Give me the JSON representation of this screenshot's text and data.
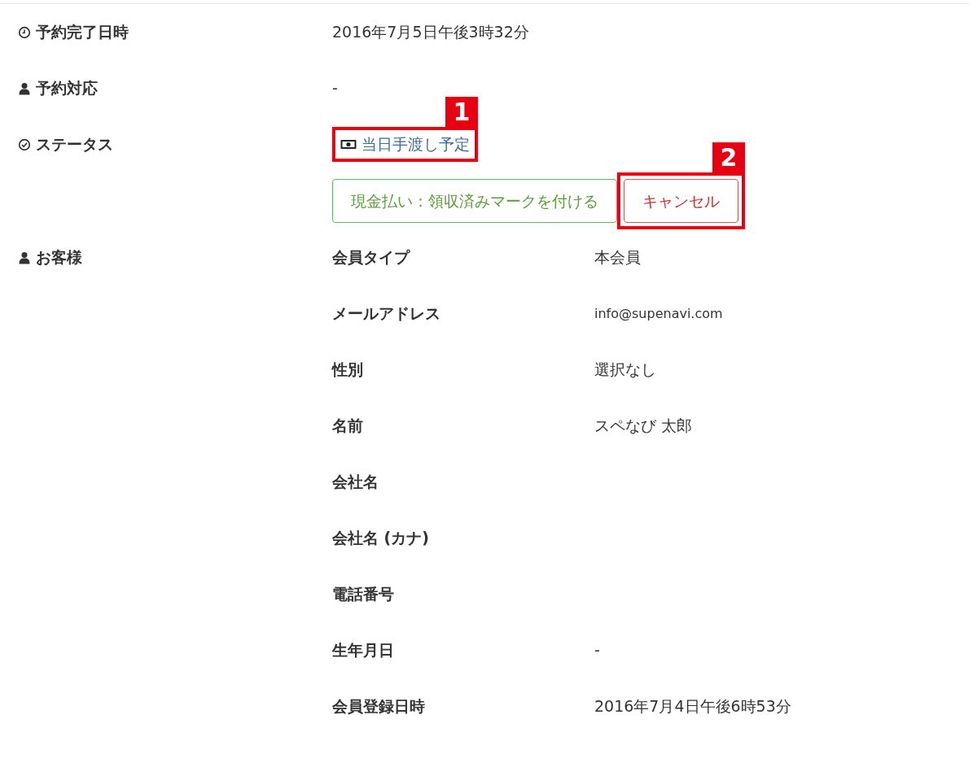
{
  "fields": [
    {
      "kind": "datetime",
      "label": "予約完了日時",
      "value": "2016年7月5日午後3時32分"
    },
    {
      "kind": "staff",
      "label": "予約対応",
      "value": "-"
    },
    {
      "kind": "status",
      "label": "ステータス",
      "status": {
        "text": "当日手渡し予定",
        "callout": "1"
      }
    }
  ],
  "actions": [
    {
      "kind": "success",
      "label": "現金払い：領収済みマークを付ける"
    },
    {
      "kind": "danger",
      "label": "キャンセル",
      "callout": "2"
    }
  ],
  "customer": {
    "label": "お客様",
    "rows": [
      {
        "label": "会員タイプ",
        "value": "本会員"
      },
      {
        "label": "メールアドレス",
        "value": "info@supenavi.com",
        "kind": "email"
      },
      {
        "label": "性別",
        "value": "選択なし"
      },
      {
        "label": "名前",
        "value": "スペなび 太郎"
      },
      {
        "label": "会社名"
      },
      {
        "label": "会社名 (カナ)"
      },
      {
        "label": "電話番号"
      },
      {
        "label": "生年月日",
        "value": "-"
      },
      {
        "label": "会員登録日時",
        "value": "2016年7月4日午後6時53分"
      }
    ]
  }
}
